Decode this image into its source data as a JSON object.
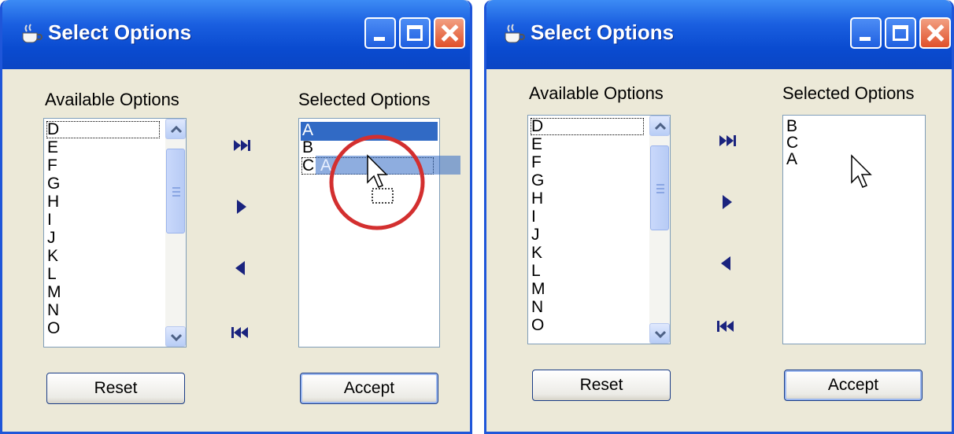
{
  "window_title": "Select Options",
  "available_label": "Available Options",
  "selected_label": "Selected Options",
  "available_items": [
    "D",
    "E",
    "F",
    "G",
    "H",
    "I",
    "J",
    "K",
    "L",
    "M",
    "N",
    "O"
  ],
  "left_selected_items": [
    "A",
    "B",
    "C"
  ],
  "drag_ghost_label": "A",
  "right_selected_items": [
    "B",
    "C",
    "A"
  ],
  "buttons": {
    "reset": "Reset",
    "accept": "Accept"
  },
  "icons": {
    "move_all_right": "double-right-arrow-icon",
    "move_right": "right-arrow-icon",
    "move_left": "left-arrow-icon",
    "move_all_left": "double-left-arrow-icon"
  },
  "colors": {
    "titlebar": "#0a4bd0",
    "selection": "#316ac5",
    "arrows": "#1a237e",
    "annotation": "#d32f2f"
  }
}
